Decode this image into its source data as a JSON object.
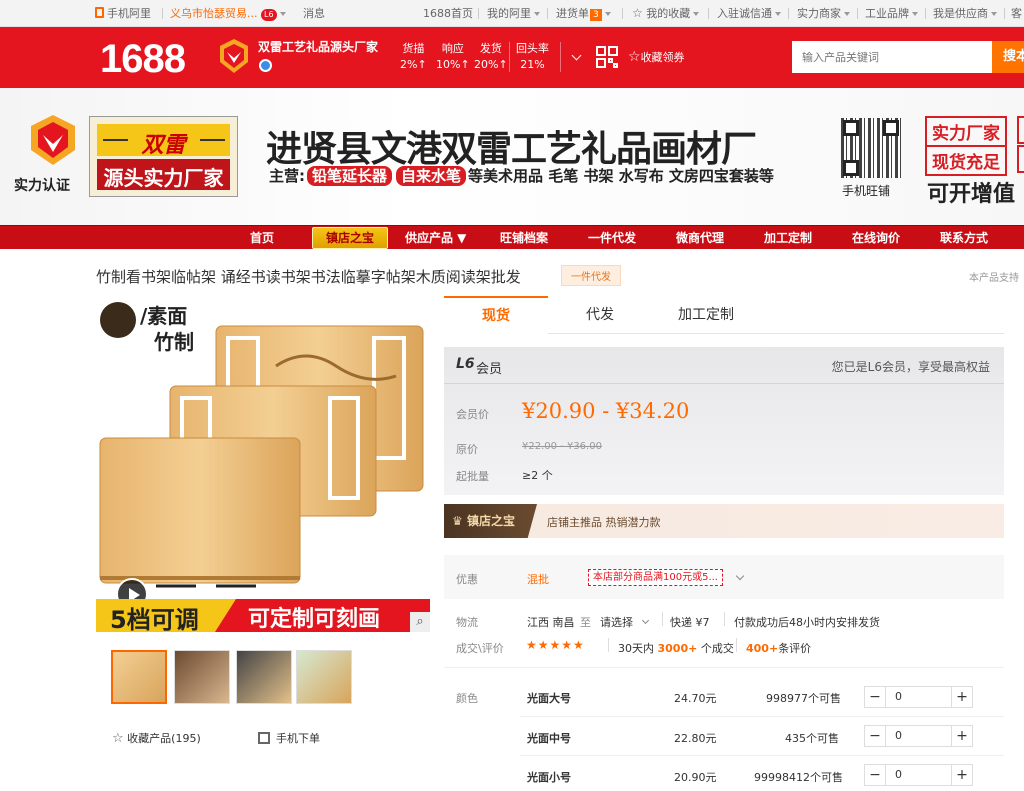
{
  "topbar": {
    "mobile": "手机阿里",
    "account": "义乌市怡瑟贸易...",
    "level_badge": "L6",
    "messages": "消息",
    "home": "1688首页",
    "my_ali": "我的阿里",
    "purchase_list": "进货单",
    "purchase_count": "3",
    "favorites": "我的收藏",
    "join": "入驻诚信通",
    "strong_merchant": "实力商家",
    "industrial": "工业品牌",
    "supplier": "我是供应商",
    "service": "客"
  },
  "header": {
    "logo": "1688",
    "shop_name": "双雷工艺礼品源头厂家",
    "metrics": [
      {
        "label": "货描",
        "value": "2%↑"
      },
      {
        "label": "响应",
        "value": "10%↑"
      },
      {
        "label": "发货",
        "value": "20%↑"
      },
      {
        "label": "回头率",
        "value": "21%"
      }
    ],
    "collect_coupon": "收藏领券",
    "search_placeholder": "输入产品关键词",
    "search_button": "搜本"
  },
  "banner": {
    "badge_label": "实力认证",
    "brand_name": "双雷",
    "brand_slogan": "源头实力厂家",
    "company_name": "进贤县文港双雷工艺礼品画材厂",
    "main_prefix": "主营:",
    "main_tag1": "铅笔延长器",
    "main_tag2": "自来水笔",
    "main_rest": "等美术用品 毛笔 书架 水写布 文房四宝套装等",
    "qr_label": "手机旺铺",
    "right_tag1": "实力厂家",
    "right_tag2": "现货充足",
    "right_text": "可开增值"
  },
  "nav": {
    "items": [
      "首页",
      "镇店之宝",
      "供应产品 ▼",
      "旺铺档案",
      "一件代发",
      "微商代理",
      "加工定制",
      "在线询价",
      "联系方式"
    ]
  },
  "product": {
    "title": "竹制看书架临帖架 诵经书读书架书法临摹字帖架木质阅读架批发",
    "title_tag": "一件代发",
    "right_note": "本产品支持",
    "image_text_top1": "/素面",
    "image_text_top2": "竹制",
    "image_banner_left": "5档可调",
    "image_banner_right": "可定制可刻画",
    "favorite": "收藏产品(195)",
    "mobile_order": "手机下单"
  },
  "tabs": [
    "现货",
    "代发",
    "加工定制"
  ],
  "price": {
    "member_level": "L6",
    "member_label": "会员",
    "member_note": "您已是L6会员，享受最高权益",
    "member_price_label": "会员价",
    "member_price": "¥20.90 - ¥34.20",
    "original_label": "原价",
    "original_price": "¥22.00 - ¥36.00",
    "moq_label": "起批量",
    "moq": "≥2 个"
  },
  "treasure": {
    "label": "镇店之宝",
    "text": "店铺主推品 热销潜力款"
  },
  "promo": {
    "label": "优惠",
    "type": "混批",
    "coupon": "本店部分商品满100元或5..."
  },
  "logistics": {
    "label": "物流",
    "origin": "江西 南昌",
    "to": "至",
    "dest": "请选择",
    "express": "快递 ¥7",
    "note": "付款成功后48小时内安排发货"
  },
  "reviews": {
    "label": "成交\\评价",
    "stars": "★★★★★",
    "deals_prefix": "30天内",
    "deals_count": "3000+",
    "deals_suffix": "个成交",
    "review_count": "400+",
    "review_suffix": "条评价"
  },
  "sku": {
    "label": "颜色",
    "rows": [
      {
        "name": "光面大号",
        "price": "24.70元",
        "stock": "998977个可售",
        "qty": "0"
      },
      {
        "name": "光面中号",
        "price": "22.80元",
        "stock": "435个可售",
        "qty": "0"
      },
      {
        "name": "光面小号",
        "price": "20.90元",
        "stock": "99998412个可售",
        "qty": "0"
      }
    ]
  },
  "colors": {
    "brand_red": "#e4151f",
    "accent_orange": "#ff6a00",
    "nav_red": "#c90d14"
  }
}
